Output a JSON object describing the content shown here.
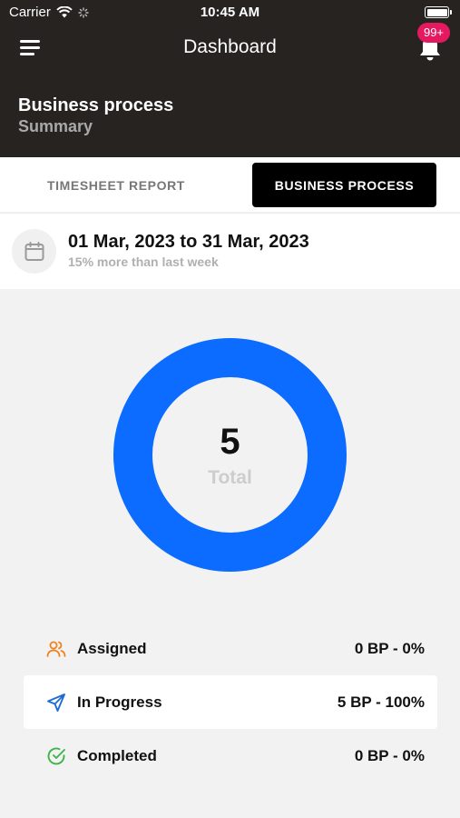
{
  "status_bar": {
    "carrier": "Carrier",
    "time": "10:45 AM"
  },
  "header": {
    "title": "Dashboard",
    "notification_badge": "99+",
    "section_title": "Business process",
    "section_subtitle": "Summary"
  },
  "tabs": [
    {
      "label": "TIMESHEET REPORT",
      "active": false
    },
    {
      "label": "BUSINESS PROCESS",
      "active": true
    }
  ],
  "date_filter": {
    "range": "01 Mar, 2023 to 31 Mar, 2023",
    "comparison": "15% more than last week"
  },
  "colors": {
    "header_bg": "#262321",
    "donut": "#0b6cff",
    "badge": "#e5195f",
    "assigned": "#f0831f",
    "in_progress": "#1f6bd8",
    "completed": "#3bb54a"
  },
  "chart_data": {
    "type": "pie",
    "center_value": "5",
    "center_label": "Total",
    "series": [
      {
        "name": "Assigned",
        "value": 0
      },
      {
        "name": "In Progress",
        "value": 5
      },
      {
        "name": "Completed",
        "value": 0
      }
    ]
  },
  "legend": [
    {
      "name": "Assigned",
      "value": "0 BP - 0%",
      "icon": "users-icon"
    },
    {
      "name": "In Progress",
      "value": "5 BP - 100%",
      "icon": "send-icon"
    },
    {
      "name": "Completed",
      "value": "0 BP - 0%",
      "icon": "check-circle-icon"
    }
  ]
}
